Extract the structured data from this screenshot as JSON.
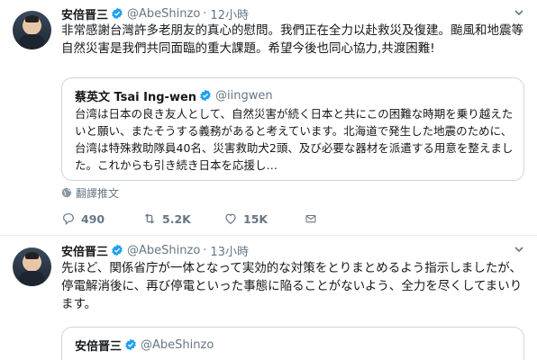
{
  "tweets": [
    {
      "author_name": "安倍晋三",
      "handle": "@AbeShinzo",
      "dot": "·",
      "time": "12小時",
      "text": "非常感謝台灣許多老朋友的真心的慰問。我們正在全力以赴救災及復建。颱風和地震等自然災害是我們共同面臨的重大課題。希望今後也同心協力,共渡困難!",
      "quote": {
        "author_name": "蔡英文 Tsai Ing-wen",
        "handle": "@iingwen",
        "text": "台湾は日本の良き友人として、自然災害が続く日本と共にこの困難な時期を乗り越えたいと願い、またそうする義務があると考えています。北海道で発生した地震のために、台湾は特殊救助隊員40名、災害救助犬2頭、及び必要な器材を派遣する用意を整えました。これからも引き続き日本を応援し…"
      },
      "translate_label": "翻譯推文",
      "replies": "490",
      "retweets": "5.2K",
      "likes": "15K"
    },
    {
      "author_name": "安倍晋三",
      "handle": "@AbeShinzo",
      "dot": "·",
      "time": "13小時",
      "text": "先ほど、関係省庁が一体となって実効的な対策をとりまとめるよう指示しましたが、停電解消後に、再び停電といった事態に陥ることがないよう、全力を尽くしてまいります。",
      "quote": {
        "author_name": "安倍晋三",
        "handle": "@AbeShinzo"
      }
    }
  ],
  "colors": {
    "verified": "#1da1f2",
    "secondary_text": "#657786",
    "border": "#e6ecf0"
  },
  "icons": [
    "verified-badge-icon",
    "chevron-down-icon",
    "globe-icon",
    "reply-icon",
    "retweet-icon",
    "like-icon",
    "direct-message-icon"
  ]
}
